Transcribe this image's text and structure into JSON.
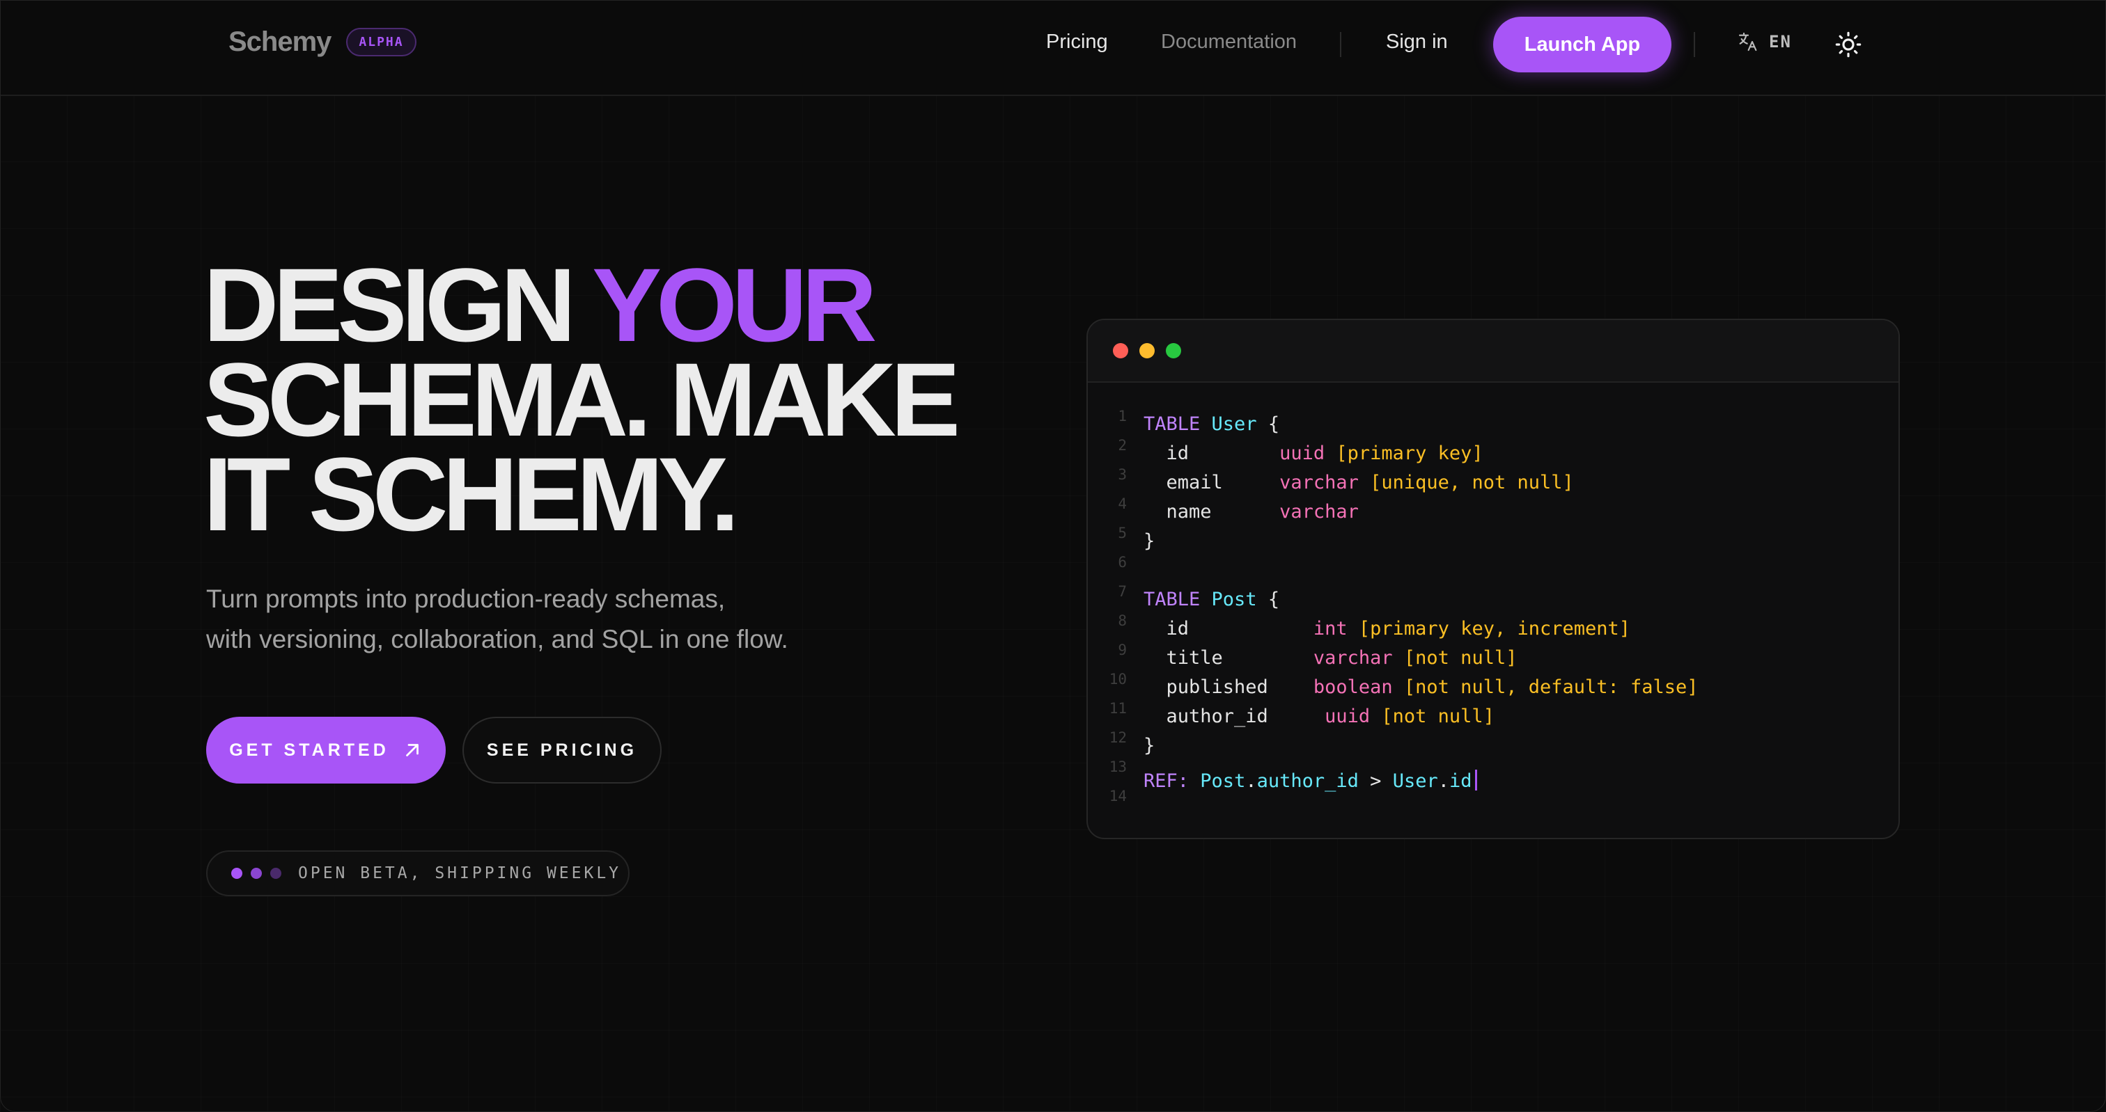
{
  "nav": {
    "brand": "Schemy",
    "badge": "ALPHA",
    "pricing": "Pricing",
    "documentation": "Documentation",
    "sign_in": "Sign in",
    "launch": "Launch App",
    "language": "EN"
  },
  "hero": {
    "line1_a": "DESIGN",
    "line1_b": "YOUR",
    "line2": "SCHEMA. MAKE",
    "line3": "IT SCHEMY.",
    "subtitle_1": "Turn prompts into production-ready schemas,",
    "subtitle_2": "with versioning, collaboration, and SQL in one flow.",
    "cta_primary": "GET STARTED",
    "cta_secondary": "SEE PRICING",
    "status": "OPEN BETA, SHIPPING WEEKLY"
  },
  "code": {
    "line_numbers": [
      "1",
      "2",
      "3",
      "4",
      "5",
      "6",
      "7",
      "8",
      "9",
      "10",
      "11",
      "12",
      "13",
      "14"
    ],
    "table1_kw": "TABLE",
    "table1_name": "User",
    "table2_kw": "TABLE",
    "table2_name": "Post",
    "ref_kw": "REF:",
    "ref_left_table": "Post",
    "ref_left_field": "author_id",
    "ref_op": ">",
    "ref_right_table": "User",
    "ref_right_field": "id"
  },
  "colors": {
    "accent": "#a855f7",
    "background": "#0b0b0b",
    "keyword": "#c084fc",
    "table_name": "#67e8f9",
    "type": "#f472b6",
    "attribute": "#fbbf24",
    "traffic_red": "#ff5f57",
    "traffic_yellow": "#febc2e",
    "traffic_green": "#28c840"
  },
  "icons": {
    "arrow": "arrow-up-right-icon",
    "translate": "translate-icon",
    "theme": "sun-icon"
  }
}
